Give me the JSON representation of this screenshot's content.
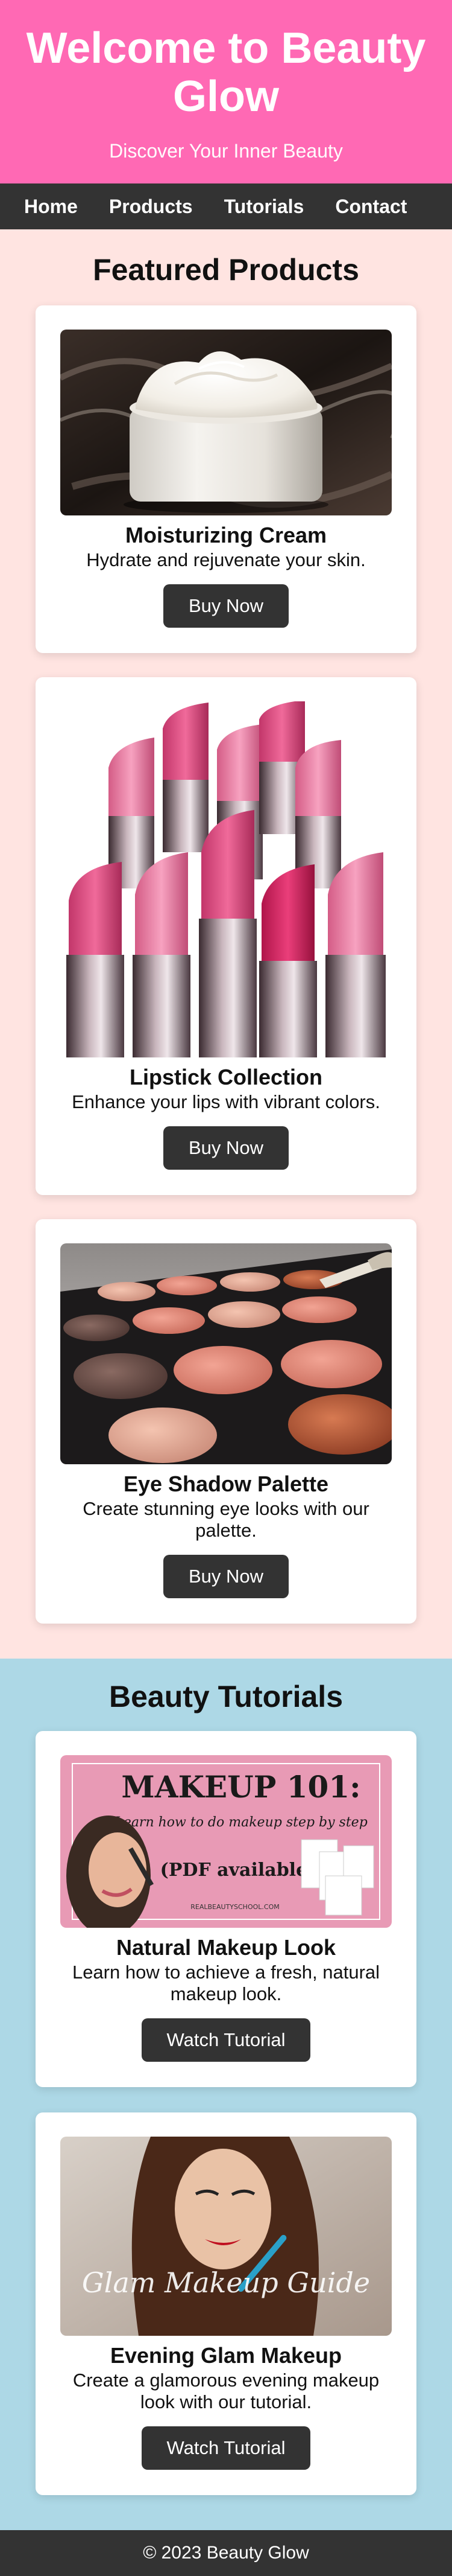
{
  "header": {
    "title": "Welcome to Beauty Glow",
    "tagline": "Discover Your Inner Beauty"
  },
  "nav": {
    "items": [
      "Home",
      "Products",
      "Tutorials",
      "Contact"
    ]
  },
  "products": {
    "heading": "Featured Products",
    "items": [
      {
        "title": "Moisturizing Cream",
        "description": "Hydrate and rejuvenate your skin.",
        "button": "Buy Now",
        "image": "cream-jar-image"
      },
      {
        "title": "Lipstick Collection",
        "description": "Enhance your lips with vibrant colors.",
        "button": "Buy Now",
        "image": "lipsticks-image"
      },
      {
        "title": "Eye Shadow Palette",
        "description": "Create stunning eye looks with our palette.",
        "button": "Buy Now",
        "image": "eyeshadow-palette-image"
      }
    ]
  },
  "tutorials": {
    "heading": "Beauty Tutorials",
    "items": [
      {
        "title": "Natural Makeup Look",
        "description": "Learn how to achieve a fresh, natural makeup look.",
        "button": "Watch Tutorial",
        "image": "makeup-101-image",
        "image_text": {
          "headline": "MAKEUP 101:",
          "script": "Learn how to do makeup step by step",
          "note": "(PDF available)",
          "site": "REALBEAUTYSCHOOL.COM"
        }
      },
      {
        "title": "Evening Glam Makeup",
        "description": "Create a glamorous evening makeup look with our tutorial.",
        "button": "Watch Tutorial",
        "image": "glam-makeup-image",
        "image_text": {
          "script": "Glam Makeup Guide"
        }
      }
    ]
  },
  "footer": {
    "text": "© 2023 Beauty Glow"
  },
  "colors": {
    "header": "#ff69b4",
    "nav": "#333333",
    "products_bg": "#ffe4e1",
    "tutorials_bg": "#add8e6",
    "button": "#333333"
  }
}
